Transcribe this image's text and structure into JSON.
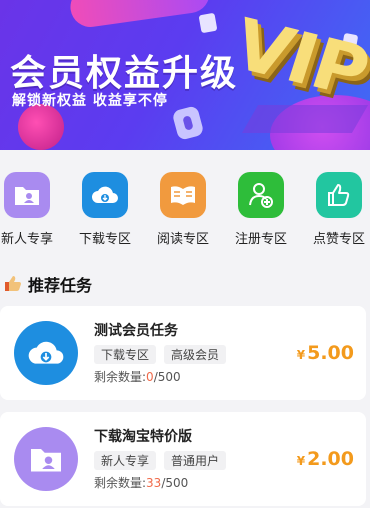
{
  "banner": {
    "title": "会员权益升级",
    "subtitle": "解锁新权益  收益享不停",
    "badge": "VIP"
  },
  "categories": [
    {
      "label": "新人专享",
      "icon": "folder-user-icon",
      "color": "#a98bf0"
    },
    {
      "label": "下载专区",
      "icon": "cloud-download-icon",
      "color": "#1e8ee0"
    },
    {
      "label": "阅读专区",
      "icon": "open-book-icon",
      "color": "#f19a3e"
    },
    {
      "label": "注册专区",
      "icon": "add-user-icon",
      "color": "#2ebd3a"
    },
    {
      "label": "点赞专区",
      "icon": "thumbs-up-icon",
      "color": "#22c6a0"
    }
  ],
  "section": {
    "title": "推荐任务",
    "icon": "thumbs-up-emoji-icon"
  },
  "tasks": [
    {
      "title": "测试会员任务",
      "tags": [
        "下载专区",
        "高级会员"
      ],
      "remain_label": "剩余数量:",
      "used": "0",
      "total": "/500",
      "currency": "¥",
      "price": "5.00",
      "icon": "cloud-download-icon",
      "color": "#1e8ee0"
    },
    {
      "title": "下载淘宝特价版",
      "tags": [
        "新人专享",
        "普通用户"
      ],
      "remain_label": "剩余数量:",
      "used": "33",
      "total": "/500",
      "currency": "¥",
      "price": "2.00",
      "icon": "folder-user-icon",
      "color": "#a98bf0"
    }
  ]
}
